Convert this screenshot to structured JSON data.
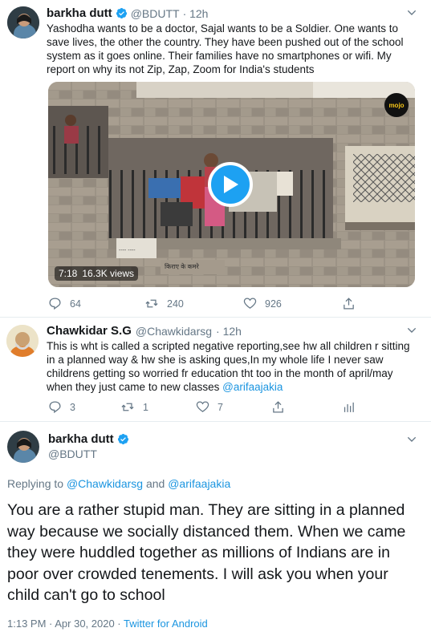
{
  "tweet1": {
    "name": "barkha dutt",
    "handle": "@BDUTT",
    "time": "· 12h",
    "text": "Yashodha wants to be a doctor, Sajal wants to be a Soldier. One wants to save lives, the other the country. They have been pushed out of the school system as it goes online. Their families have no smartphones or wifi. My report on why its not Zip, Zap, Zoom for India's students",
    "video": {
      "duration": "7:18",
      "views": "16.3K views",
      "badge": "mojo"
    },
    "replies": "64",
    "retweets": "240",
    "likes": "926"
  },
  "tweet2": {
    "name": "Chawkidar S.G",
    "handle": "@Chawkidarsg",
    "time": "· 12h",
    "text": "This is wht is called a scripted negative reporting,see hw all children r sitting in a planned way & hw she is asking ques,In my whole life I never saw childrens getting so worried fr education tht too in the month of april/may when they just came to new classes",
    "mention": "@arifaajakia",
    "replies": "3",
    "retweets": "1",
    "likes": "7"
  },
  "tweet3": {
    "name": "barkha dutt",
    "handle": "@BDUTT",
    "replying_prefix": "Replying to",
    "replying_to_1": "@Chawkidarsg",
    "replying_and": "and",
    "replying_to_2": "@arifaajakia",
    "text": "You are a rather stupid man. They are sitting in a planned way because we socially distanced them. When we came they were huddled together as millions of Indians are in poor over crowded tenements. I will ask you when your child can't go to school",
    "timestamp": "1:13 PM · Apr 30, 2020 · ",
    "client": "Twitter for Android"
  },
  "colors": {
    "accent": "#1da1f2",
    "link": "#1b95e0",
    "muted": "#657786",
    "divider": "#e6ecf0"
  }
}
